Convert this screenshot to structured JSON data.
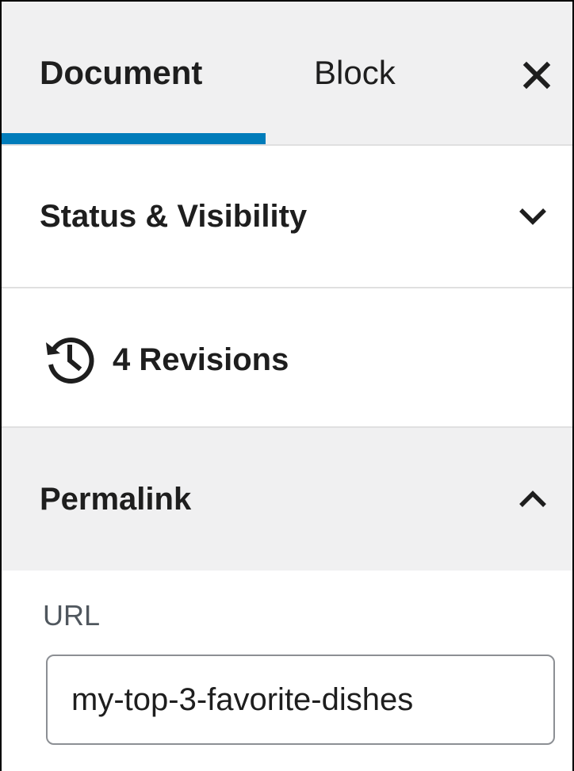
{
  "tabs": {
    "document_label": "Document",
    "block_label": "Block",
    "active_color": "#007cba"
  },
  "close": {
    "icon": "close-icon"
  },
  "status_panel": {
    "title": "Status & Visibility",
    "expanded": false,
    "icon": "chevron-down-icon"
  },
  "revisions": {
    "label": "4 Revisions",
    "icon": "history-icon"
  },
  "permalink_panel": {
    "title": "Permalink",
    "expanded": true,
    "icon": "chevron-up-icon",
    "url_label": "URL",
    "url_value": "my-top-3-favorite-dishes"
  }
}
